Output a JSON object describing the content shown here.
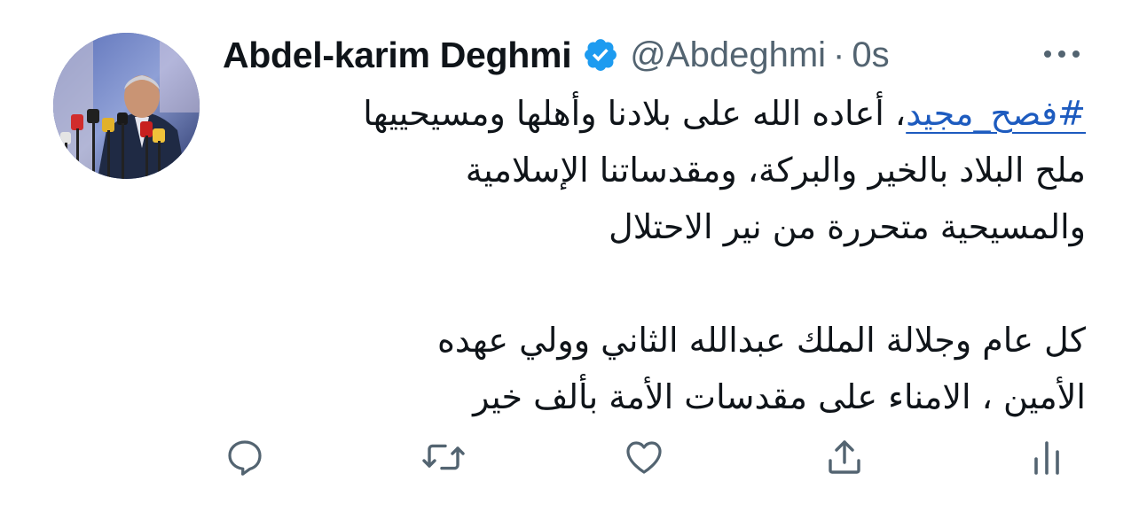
{
  "tweet": {
    "author": {
      "display_name": "Abdel-karim Deghmi",
      "handle": "@Abdeghmi",
      "verified": true
    },
    "separator": "·",
    "timestamp": "0s",
    "hashtag": "#فصح_مجيد",
    "text_lines": [
      "، أعاده الله على بلادنا وأهلها ومسيحييها",
      "ملح البلاد بالخير والبركة، ومقدساتنا الإسلامية",
      "والمسيحية متحررة من نير الاحتلال",
      "",
      "كل عام وجلالة الملك عبدالله الثاني وولي عهده",
      "الأمين ، الامناء على مقدسات الأمة بألف خير"
    ]
  },
  "icons": {
    "verified": "verified-badge-icon",
    "more": "more-dots-icon",
    "reply": "reply-icon",
    "retweet": "retweet-icon",
    "like": "like-icon",
    "share": "share-icon",
    "analytics": "analytics-icon"
  },
  "colors": {
    "text": "#0f1419",
    "secondary": "#536471",
    "verified": "#1d9bf0",
    "link": "#1d5bbf"
  }
}
